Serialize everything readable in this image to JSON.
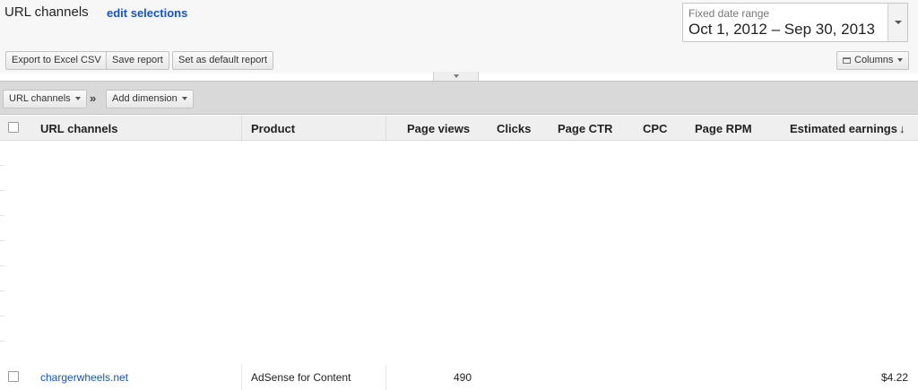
{
  "header": {
    "title": "URL channels",
    "edit_link": "edit selections"
  },
  "date_range": {
    "label": "Fixed date range",
    "value": "Oct 1, 2012 – Sep 30, 2013"
  },
  "toolbar": {
    "export_label": "Export to Excel CSV",
    "save_label": "Save report",
    "default_label": "Set as default report",
    "columns_label": "Columns"
  },
  "dimensions": {
    "primary": "URL channels",
    "separator": "»",
    "add_label": "Add dimension"
  },
  "table": {
    "columns": [
      "URL channels",
      "Product",
      "Page views",
      "Clicks",
      "Page CTR",
      "CPC",
      "Page RPM",
      "Estimated earnings"
    ],
    "sort_indicator": "↓",
    "rows": [
      {
        "channel": "chargerwheels.net",
        "product": "AdSense for Content",
        "page_views": "490",
        "clicks": "",
        "page_ctr": "",
        "cpc": "",
        "page_rpm": "",
        "earnings": "$4.22"
      }
    ]
  },
  "colors": {
    "link": "#1155cc",
    "toolbar_bg": "#f7f7f7",
    "dimension_bar_bg": "#d9d9d9",
    "header_bg": "#efefef"
  }
}
